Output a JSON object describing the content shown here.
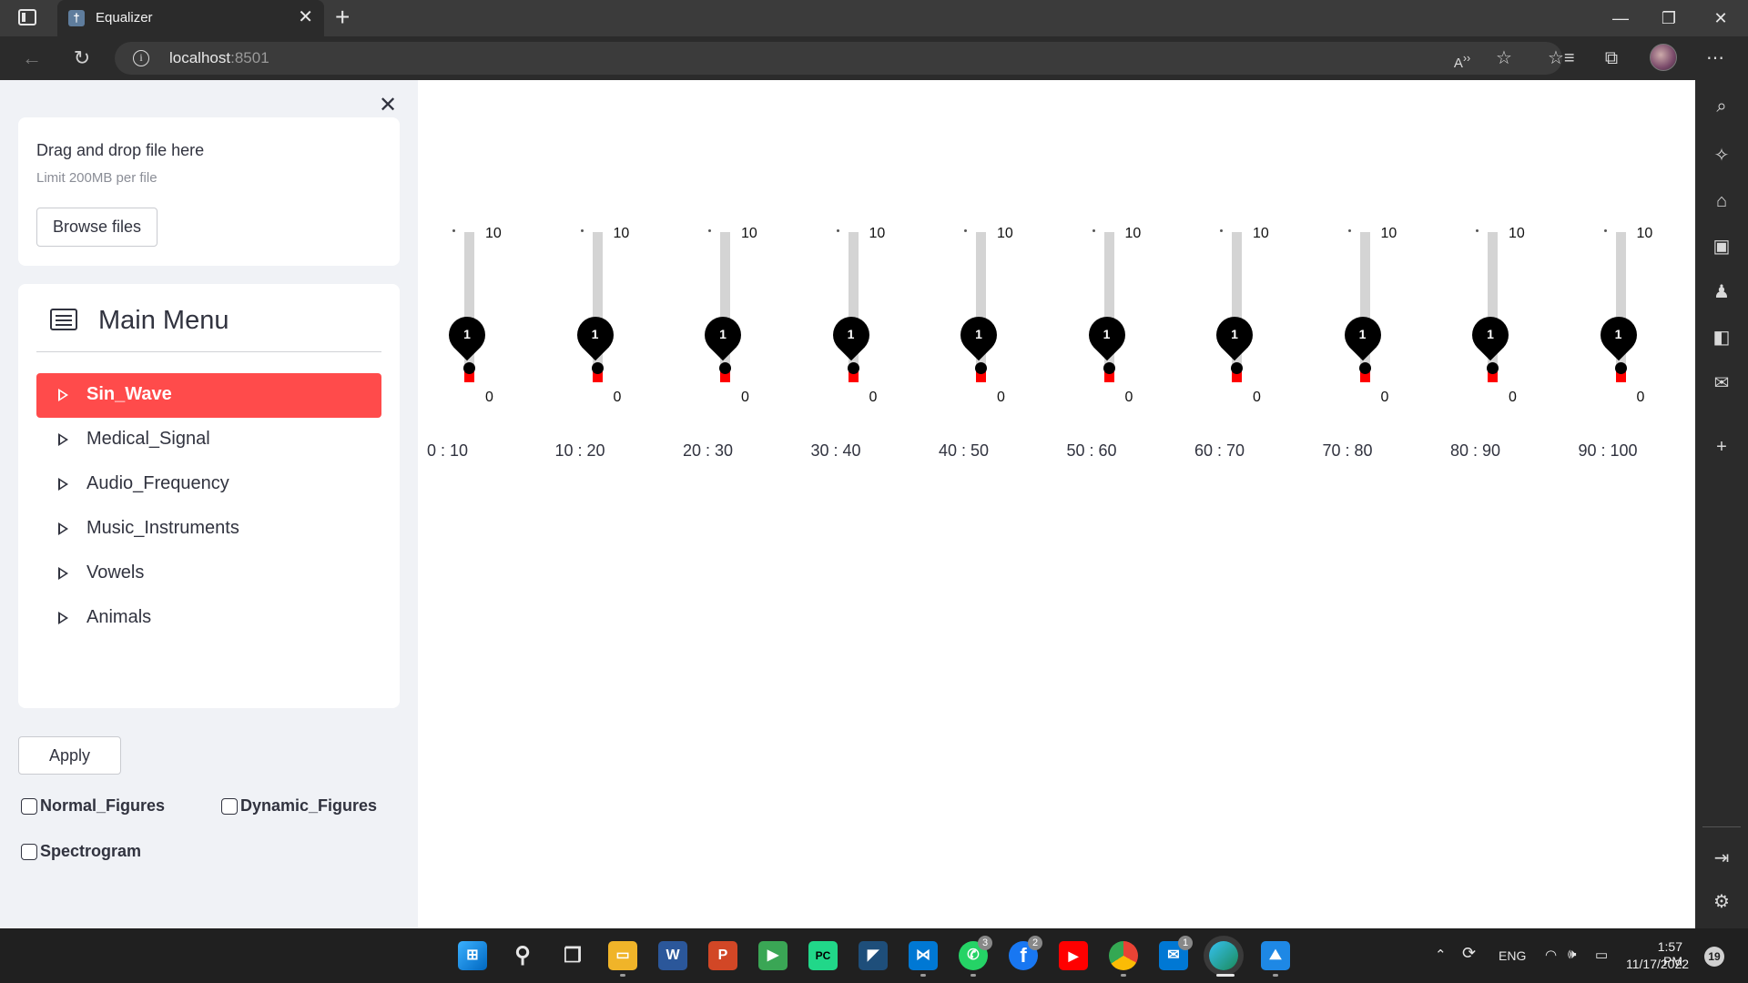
{
  "browser": {
    "tab_title": "Equalizer",
    "tab_close": "✕",
    "new_tab": "+",
    "url_host": "localhost",
    "url_port": ":8501",
    "window_controls": {
      "minimize": "—",
      "restore": "❐",
      "close": "✕"
    }
  },
  "sidebar": {
    "close_symbol": "✕",
    "uploader": {
      "drop_text": "Drag and drop file here",
      "limit_text": "Limit 200MB per file",
      "browse_label": "Browse files"
    },
    "menu": {
      "title": "Main Menu",
      "items": [
        {
          "label": "Sin_Wave",
          "active": true
        },
        {
          "label": "Medical_Signal",
          "active": false
        },
        {
          "label": "Audio_Frequency",
          "active": false
        },
        {
          "label": "Music_Instruments",
          "active": false
        },
        {
          "label": "Vowels",
          "active": false
        },
        {
          "label": "Animals",
          "active": false
        }
      ]
    },
    "apply_label": "Apply",
    "checkboxes": [
      {
        "label": "Normal_Figures",
        "checked": false
      },
      {
        "label": "Dynamic_Figures",
        "checked": false
      },
      {
        "label": "Spectrogram",
        "checked": false
      }
    ]
  },
  "equalizer": {
    "min": "0",
    "max": "10",
    "sliders": [
      {
        "band": "0 : 10",
        "value": 1
      },
      {
        "band": "10 : 20",
        "value": 1
      },
      {
        "band": "20 : 30",
        "value": 1
      },
      {
        "band": "30 : 40",
        "value": 1
      },
      {
        "band": "40 : 50",
        "value": 1
      },
      {
        "band": "50 : 60",
        "value": 1
      },
      {
        "band": "60 : 70",
        "value": 1
      },
      {
        "band": "70 : 80",
        "value": 1
      },
      {
        "band": "80 : 90",
        "value": 1
      },
      {
        "band": "90 : 100",
        "value": 1
      }
    ],
    "colors": {
      "fill": "#ff0000",
      "track": "#d4d4d4",
      "knob": "#000000"
    }
  },
  "colors": {
    "accent": "#ff4b4b",
    "sidebar_bg": "#f0f2f6",
    "text": "#31333f"
  },
  "taskbar": {
    "badges": {
      "whatsapp": "3",
      "facebook": "2",
      "mail": "1"
    },
    "language": "ENG",
    "time": "1:57 PM",
    "date": "11/17/2022",
    "notifications": "19"
  }
}
